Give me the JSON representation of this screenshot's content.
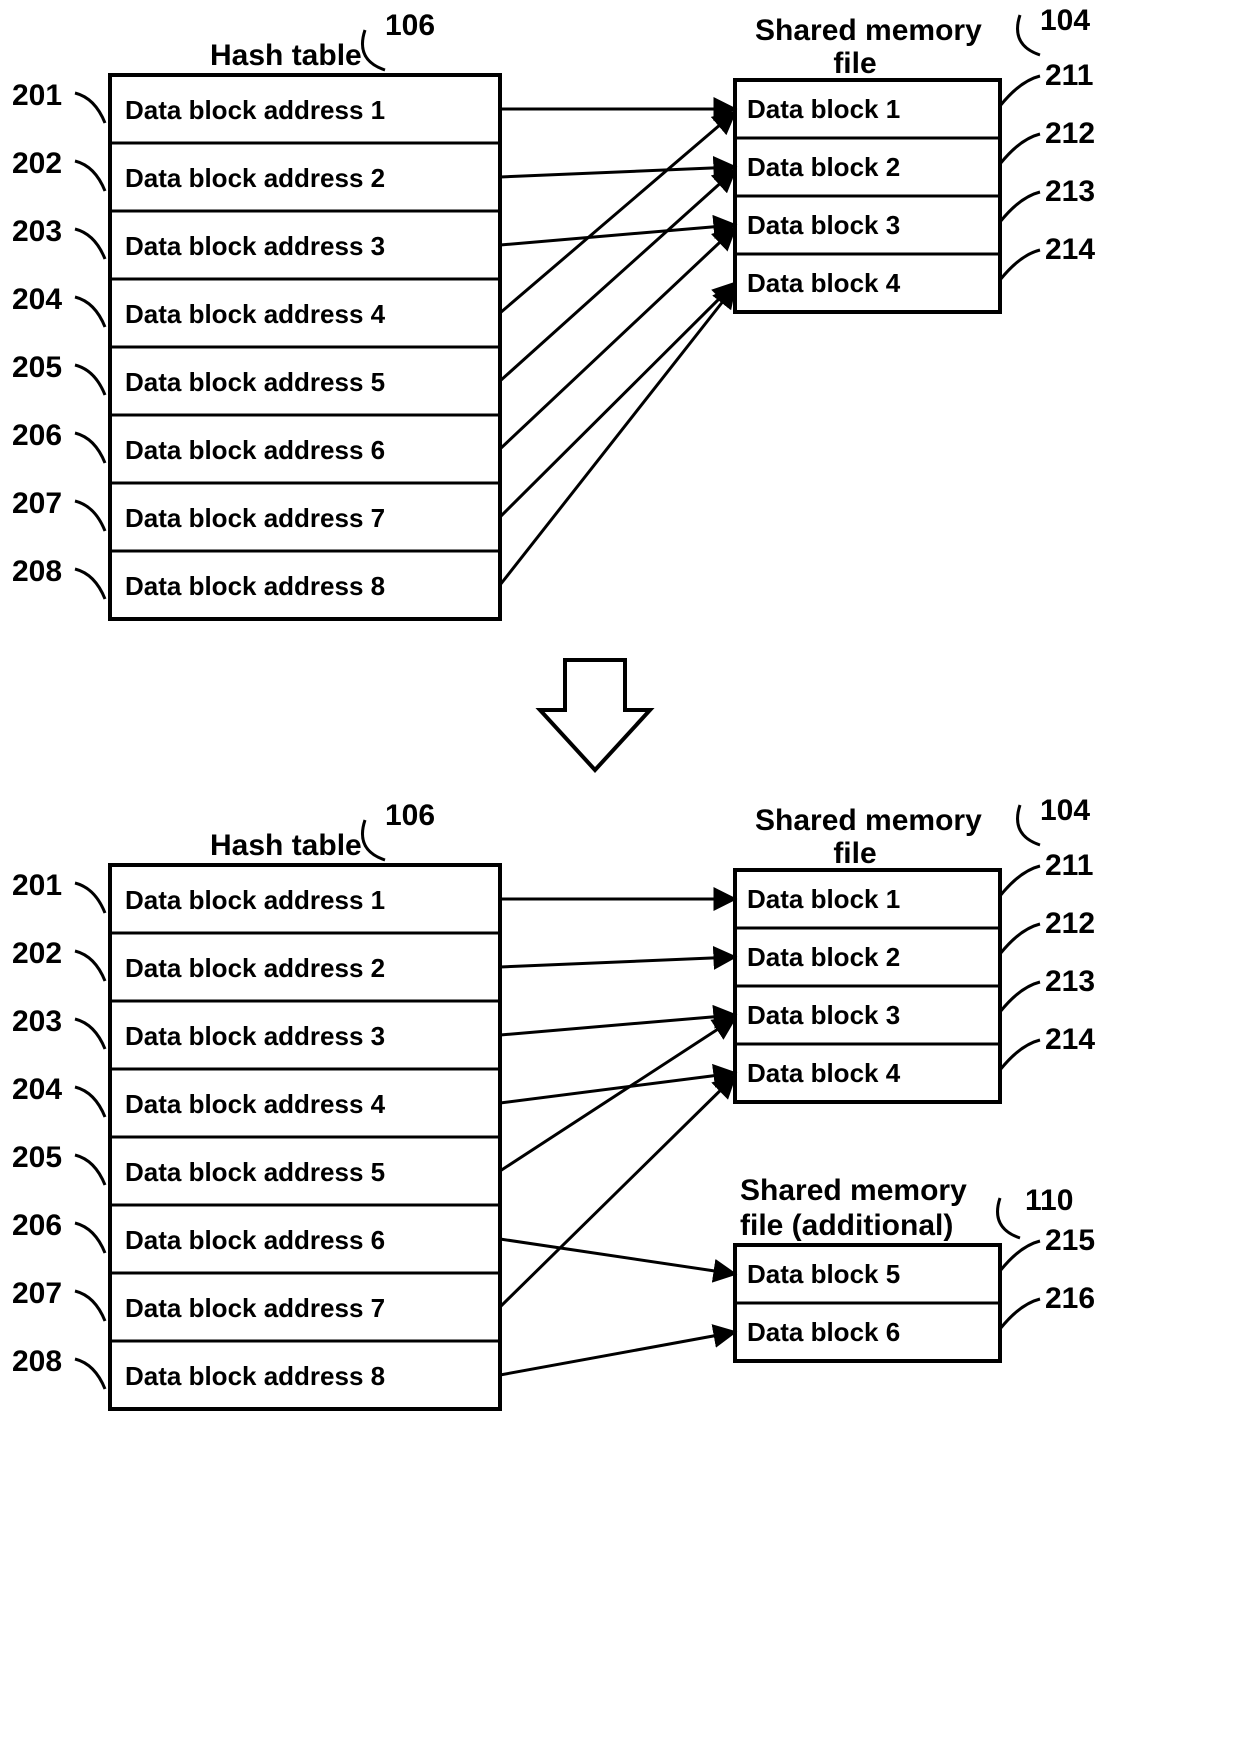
{
  "top": {
    "hash_title": "Hash table",
    "hash_ref": "106",
    "mem_title_l1": "Shared memory",
    "mem_title_l2": "file",
    "mem_ref": "104",
    "hash_rows": [
      {
        "label": "Data block address 1",
        "ref": "201"
      },
      {
        "label": "Data block address 2",
        "ref": "202"
      },
      {
        "label": "Data block address 3",
        "ref": "203"
      },
      {
        "label": "Data block address 4",
        "ref": "204"
      },
      {
        "label": "Data block address 5",
        "ref": "205"
      },
      {
        "label": "Data block address 6",
        "ref": "206"
      },
      {
        "label": "Data block address 7",
        "ref": "207"
      },
      {
        "label": "Data block address 8",
        "ref": "208"
      }
    ],
    "mem_rows": [
      {
        "label": "Data block 1",
        "ref": "211"
      },
      {
        "label": "Data block 2",
        "ref": "212"
      },
      {
        "label": "Data block 3",
        "ref": "213"
      },
      {
        "label": "Data block 4",
        "ref": "214"
      }
    ]
  },
  "bottom": {
    "hash_title": "Hash table",
    "hash_ref": "106",
    "mem_title_l1": "Shared memory",
    "mem_title_l2": "file",
    "mem_ref": "104",
    "mem2_title_l1": "Shared memory",
    "mem2_title_l2": "file (additional)",
    "mem2_ref": "110",
    "hash_rows": [
      {
        "label": "Data block address 1",
        "ref": "201"
      },
      {
        "label": "Data block address 2",
        "ref": "202"
      },
      {
        "label": "Data block address 3",
        "ref": "203"
      },
      {
        "label": "Data block address 4",
        "ref": "204"
      },
      {
        "label": "Data block address 5",
        "ref": "205"
      },
      {
        "label": "Data block address 6",
        "ref": "206"
      },
      {
        "label": "Data block address 7",
        "ref": "207"
      },
      {
        "label": "Data block address 8",
        "ref": "208"
      }
    ],
    "mem_rows": [
      {
        "label": "Data block 1",
        "ref": "211"
      },
      {
        "label": "Data block 2",
        "ref": "212"
      },
      {
        "label": "Data block 3",
        "ref": "213"
      },
      {
        "label": "Data block 4",
        "ref": "214"
      }
    ],
    "mem2_rows": [
      {
        "label": "Data block 5",
        "ref": "215"
      },
      {
        "label": "Data block 6",
        "ref": "216"
      }
    ]
  }
}
